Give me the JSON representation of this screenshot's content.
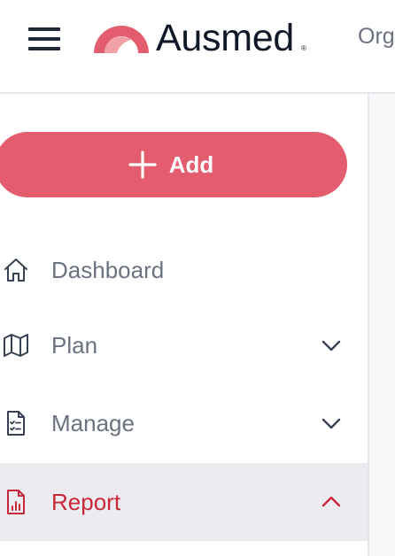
{
  "header": {
    "menu_icon": "hamburger-menu-icon",
    "logo_text": "Ausmed",
    "logo_reg": "®",
    "org_text": "Org",
    "brand_color": "#e35d6e"
  },
  "sidebar": {
    "add_button": {
      "label": "Add",
      "icon": "plus-icon"
    },
    "items": [
      {
        "label": "Dashboard",
        "icon": "home-icon",
        "chevron": null,
        "active": false
      },
      {
        "label": "Plan",
        "icon": "map-icon",
        "chevron": "chevron-down-icon",
        "active": false
      },
      {
        "label": "Manage",
        "icon": "checklist-document-icon",
        "chevron": "chevron-down-icon",
        "active": false
      },
      {
        "label": "Report",
        "icon": "report-chart-icon",
        "chevron": "chevron-up-icon",
        "active": true
      }
    ],
    "active_color": "#c8283a"
  }
}
